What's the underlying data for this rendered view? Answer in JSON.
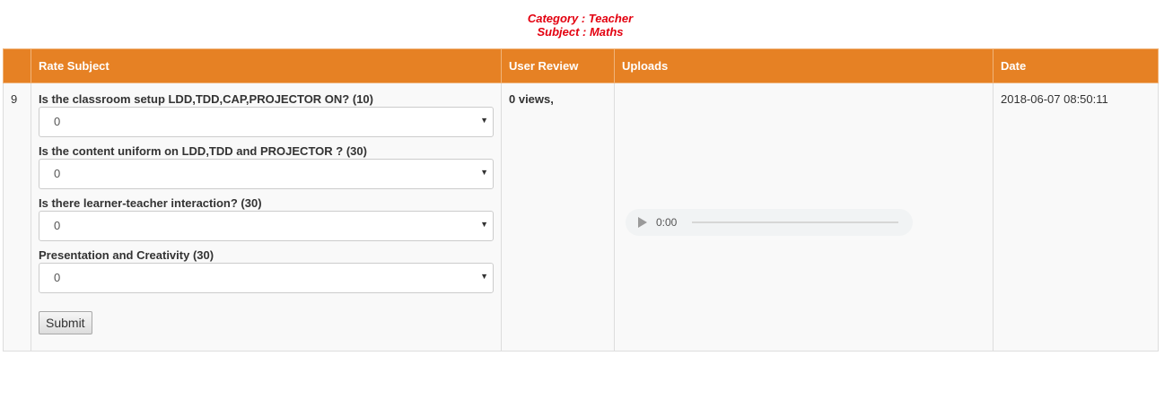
{
  "header": {
    "category": "Category : Teacher",
    "subject": "Subject : Maths"
  },
  "table": {
    "columns": [
      "",
      "Rate Subject",
      "User Review",
      "Uploads",
      "Date"
    ],
    "row": {
      "number": "9",
      "questions": [
        {
          "label": "Is the classroom setup LDD,TDD,CAP,PROJECTOR ON? (10)",
          "selected": "0"
        },
        {
          "label": "Is the content uniform on LDD,TDD and PROJECTOR ? (30)",
          "selected": "0"
        },
        {
          "label": "Is there learner-teacher interaction? (30)",
          "selected": "0"
        },
        {
          "label": "Presentation and Creativity (30)",
          "selected": "0"
        }
      ],
      "submit_label": "Submit",
      "review": "0 views,",
      "audio_time": "0:00",
      "date": "2018-06-07 08:50:11"
    }
  },
  "icons": {
    "dropdown": "chevron-down-icon",
    "play": "play-icon"
  },
  "colors": {
    "header_bg": "#e68124",
    "title_red": "#e3000f"
  }
}
